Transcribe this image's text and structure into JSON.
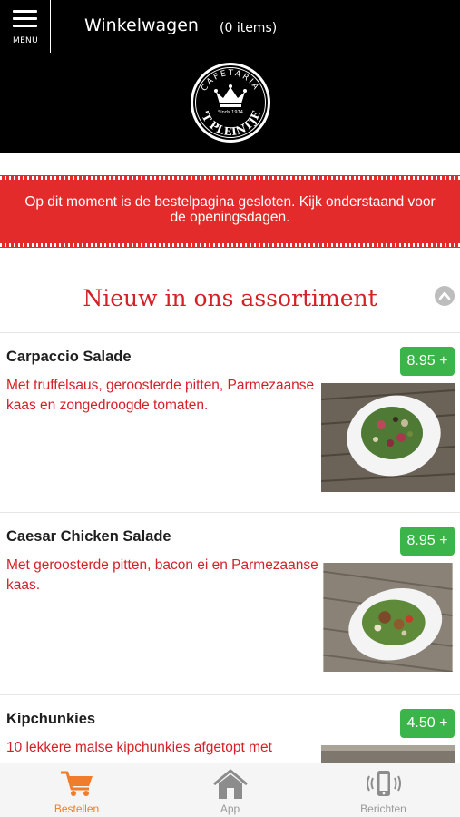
{
  "header": {
    "menu_label": "MENU",
    "cart_title": "Winkelwagen",
    "cart_count": "(0 items)",
    "logo": {
      "top_text": "CAFETARIA",
      "since_text": "Sinds 1974",
      "bottom_text": "'T PLEINTJE"
    }
  },
  "banner": {
    "message": "Op dit moment is de bestelpagina gesloten. Kijk onderstaand voor de openingsdagen.",
    "color": "#e32b2b"
  },
  "section": {
    "title": "Nieuw in ons assortiment",
    "collapse_icon": "chevron-up-icon"
  },
  "products": [
    {
      "name": "Carpaccio Salade",
      "price": "8.95 +",
      "description": "Met truffelsaus, geroosterde pitten, Parmezaanse kaas en zongedroogde tomaten."
    },
    {
      "name": "Caesar Chicken Salade",
      "price": "8.95 +",
      "description": "Met geroosterde pitten, bacon ei en Parmezaanse kaas."
    },
    {
      "name": "Kipchunkies",
      "price": "4.50 +",
      "description": "10 lekkere malse kipchunkies afgetopt met"
    }
  ],
  "tabbar": {
    "tabs": [
      {
        "label": "Bestellen",
        "icon": "cart-icon",
        "active": true
      },
      {
        "label": "App",
        "icon": "home-icon",
        "active": false
      },
      {
        "label": "Berichten",
        "icon": "phone-vibrate-icon",
        "active": false
      }
    ]
  },
  "colors": {
    "accent_red": "#d42127",
    "price_green": "#3bb54a",
    "tab_active": "#f07d2c",
    "header_bg": "#000000"
  }
}
